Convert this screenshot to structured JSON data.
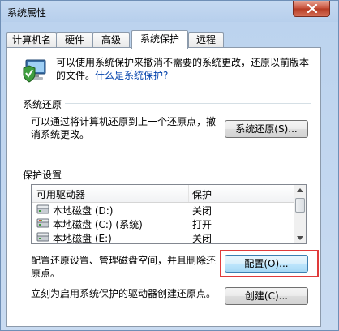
{
  "window": {
    "title": "系统属性",
    "close_label": "×"
  },
  "tabs": [
    {
      "label": "计算机名",
      "active": false
    },
    {
      "label": "硬件",
      "active": false
    },
    {
      "label": "高级",
      "active": false
    },
    {
      "label": "系统保护",
      "active": true
    },
    {
      "label": "远程",
      "active": false
    }
  ],
  "intro": {
    "text": "可以使用系统保护来撤消不需要的系统更改，还原以前版本的文件。",
    "link": "什么是系统保护?"
  },
  "restore": {
    "group_label": "系统还原",
    "description": "可以通过将计算机还原到上一个还原点，撤消系统更改。",
    "button_label": "系统还原(S)..."
  },
  "protection": {
    "group_label": "保护设置",
    "columns": [
      "可用驱动器",
      "保护"
    ],
    "drives": [
      {
        "name": "本地磁盘 (D:)",
        "protection": "关闭"
      },
      {
        "name": "本地磁盘 (C:) (系统)",
        "protection": "打开"
      },
      {
        "name": "本地磁盘 (E:)",
        "protection": "关闭"
      }
    ],
    "configure_text": "配置还原设置、管理磁盘空间，并且删除还原点。",
    "configure_button": "配置(O)...",
    "create_text": "立刻为启用系统保护的驱动器创建还原点。",
    "create_button": "创建(C)..."
  },
  "colors": {
    "highlight": "#e03a3a",
    "link": "#0645ad"
  }
}
